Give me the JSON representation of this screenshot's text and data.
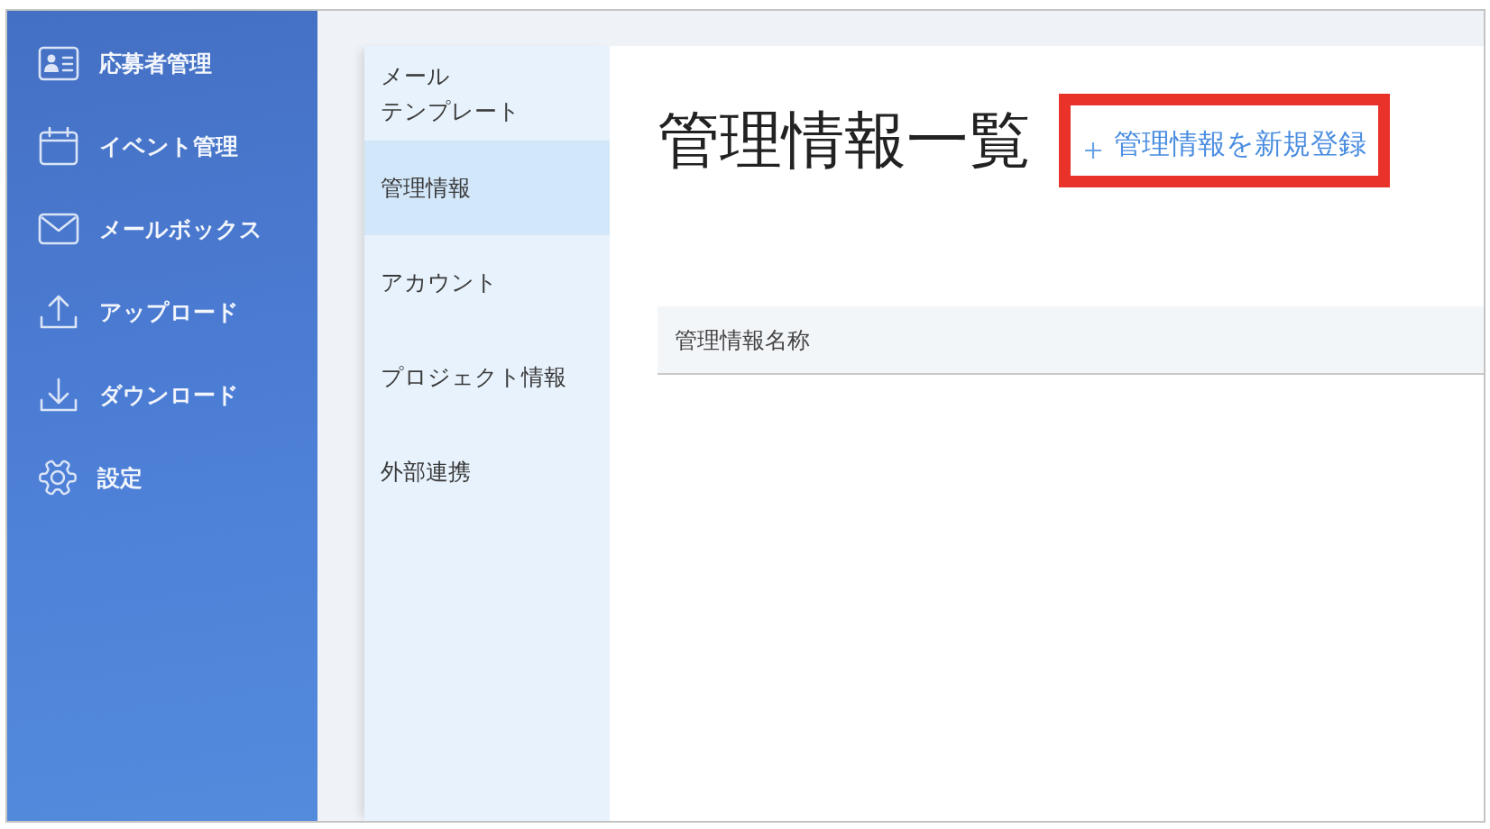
{
  "sidebar": {
    "items": [
      {
        "label": "応募者管理"
      },
      {
        "label": "イベント管理"
      },
      {
        "label": "メールボックス"
      },
      {
        "label": "アップロード"
      },
      {
        "label": "ダウンロード"
      },
      {
        "label": "設定"
      }
    ]
  },
  "submenu": {
    "items": [
      {
        "label": "メールテンプレート",
        "selected": false
      },
      {
        "label": "管理情報",
        "selected": true
      },
      {
        "label": "アカウント",
        "selected": false
      },
      {
        "label": "プロジェクト情報",
        "selected": false
      },
      {
        "label": "外部連携",
        "selected": false
      }
    ]
  },
  "main": {
    "title": "管理情報一覧",
    "add_button": {
      "label": "管理情報を新規登録",
      "highlighted": true
    },
    "table": {
      "columns": [
        "管理情報名称"
      ]
    }
  }
}
